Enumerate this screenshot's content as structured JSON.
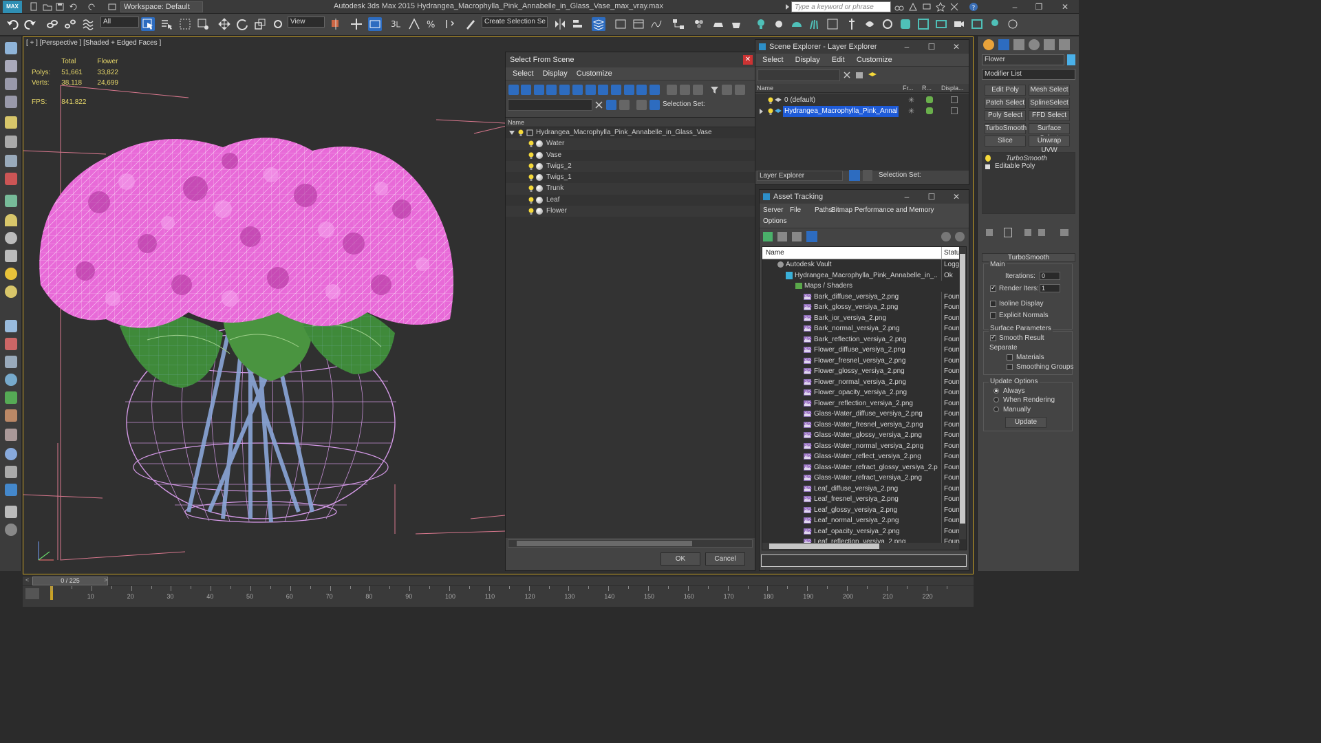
{
  "title_bar": {
    "logo": "MAX",
    "workspace": "Workspace: Default",
    "app_title": "Autodesk 3ds Max  2015     Hydrangea_Macrophylla_Pink_Annabelle_in_Glass_Vase_max_vray.max",
    "search_placeholder": "Type a keyword or phrase",
    "window_buttons": [
      "–",
      "❐",
      "✕"
    ]
  },
  "toolbar": {
    "filter_value": "All",
    "coord_system": "View",
    "selection_set": "Create Selection Se"
  },
  "viewport": {
    "label": "[ + ] [Perspective ] [Shaded + Edged Faces ]",
    "stats": {
      "col_total": "Total",
      "col_flower": "Flower",
      "polys_label": "Polys:",
      "polys_total": "51,661",
      "polys_flower": "33,822",
      "verts_label": "Verts:",
      "verts_total": "38,118",
      "verts_flower": "24,699",
      "fps_label": "FPS:",
      "fps_value": "841.822"
    }
  },
  "select_from_scene": {
    "title": "Select From Scene",
    "menu": [
      "Select",
      "Display",
      "Customize"
    ],
    "selection_set_label": "Selection Set:",
    "column_name": "Name",
    "root": "Hydrangea_Macrophylla_Pink_Annabelle_in_Glass_Vase",
    "children": [
      "Water",
      "Vase",
      "Twigs_2",
      "Twigs_1",
      "Trunk",
      "Leaf",
      "Flower"
    ],
    "ok": "OK",
    "cancel": "Cancel"
  },
  "scene_explorer": {
    "title": "Scene Explorer - Layer Explorer",
    "menu": [
      "Select",
      "Display",
      "Edit",
      "Customize"
    ],
    "columns": [
      "Name",
      "Fr...",
      "R...",
      "Displa..."
    ],
    "rows": [
      "0 (default)",
      "Hydrangea_Macrophylla_Pink_Annabell..."
    ],
    "mode": "Layer Explorer",
    "selection_set_label": "Selection Set:"
  },
  "asset_tracking": {
    "title": "Asset Tracking",
    "menu": [
      "Server",
      "File",
      "Paths",
      "Bitmap Performance and Memory",
      "Options"
    ],
    "col_name": "Name",
    "col_status": "Statu",
    "vault": {
      "name": "Autodesk Vault",
      "status": "Logg"
    },
    "file": {
      "name": "Hydrangea_Macrophylla_Pink_Annabelle_in_...",
      "status": "Ok"
    },
    "folder": "Maps / Shaders",
    "maps": [
      {
        "name": "Bark_diffuse_versiya_2.png",
        "status": "Foun"
      },
      {
        "name": "Bark_glossy_versiya_2.png",
        "status": "Foun"
      },
      {
        "name": "Bark_ior_versiya_2.png",
        "status": "Foun"
      },
      {
        "name": "Bark_normal_versiya_2.png",
        "status": "Foun"
      },
      {
        "name": "Bark_reflection_versiya_2.png",
        "status": "Foun"
      },
      {
        "name": "Flower_diffuse_versiya_2.png",
        "status": "Foun"
      },
      {
        "name": "Flower_fresnel_versiya_2.png",
        "status": "Foun"
      },
      {
        "name": "Flower_glossy_versiya_2.png",
        "status": "Foun"
      },
      {
        "name": "Flower_normal_versiya_2.png",
        "status": "Foun"
      },
      {
        "name": "Flower_opacity_versiya_2.png",
        "status": "Foun"
      },
      {
        "name": "Flower_reflection_versiya_2.png",
        "status": "Foun"
      },
      {
        "name": "Glass-Water_diffuse_versiya_2.png",
        "status": "Foun"
      },
      {
        "name": "Glass-Water_fresnel_versiya_2.png",
        "status": "Foun"
      },
      {
        "name": "Glass-Water_glossy_versiya_2.png",
        "status": "Foun"
      },
      {
        "name": "Glass-Water_normal_versiya_2.png",
        "status": "Foun"
      },
      {
        "name": "Glass-Water_reflect_versiya_2.png",
        "status": "Foun"
      },
      {
        "name": "Glass-Water_refract_glossy_versiya_2.p...",
        "status": "Foun"
      },
      {
        "name": "Glass-Water_refract_versiya_2.png",
        "status": "Foun"
      },
      {
        "name": "Leaf_diffuse_versiya_2.png",
        "status": "Foun"
      },
      {
        "name": "Leaf_fresnel_versiya_2.png",
        "status": "Foun"
      },
      {
        "name": "Leaf_glossy_versiya_2.png",
        "status": "Foun"
      },
      {
        "name": "Leaf_normal_versiya_2.png",
        "status": "Foun"
      },
      {
        "name": "Leaf_opacity_versiya_2.png",
        "status": "Foun"
      },
      {
        "name": "Leaf_reflection_versiya_2.png",
        "status": "Foun"
      }
    ]
  },
  "command_panel": {
    "object_name": "Flower",
    "modifier_list": "Modifier List",
    "buttons": [
      "Edit Poly",
      "Mesh Select",
      "Patch Select",
      "SplineSelect",
      "Poly Select",
      "FFD Select",
      "TurboSmooth",
      "Surface Select",
      "Slice",
      "Unwrap UVW"
    ],
    "stack": [
      "TurboSmooth",
      "Editable Poly"
    ],
    "rollout_title": "TurboSmooth",
    "main_label": "Main",
    "iterations_label": "Iterations:",
    "iterations_value": "0",
    "render_iters_label": "Render Iters:",
    "render_iters_value": "1",
    "isoline_label": "Isoline Display",
    "explicit_label": "Explicit Normals",
    "surface_params_label": "Surface Parameters",
    "smooth_result_label": "Smooth Result",
    "separate_label": "Separate",
    "materials_label": "Materials",
    "smoothing_groups_label": "Smoothing Groups",
    "update_options_label": "Update Options",
    "always_label": "Always",
    "when_rendering_label": "When Rendering",
    "manually_label": "Manually",
    "update_button": "Update"
  },
  "timeline": {
    "frame_counter": "0 / 225",
    "ticks": [
      "10",
      "20",
      "30",
      "40",
      "50",
      "60",
      "70",
      "80",
      "90",
      "100",
      "110",
      "120",
      "130",
      "140",
      "150",
      "160",
      "170",
      "180",
      "190",
      "200",
      "210",
      "220"
    ]
  },
  "colors": {
    "flower": "#e86ad8",
    "leaf": "#3f8a3a",
    "vase_wire": "#d59ae8",
    "stem": "#8aa6d8",
    "selection_highlight": "#1e5bd8",
    "viewport_border": "#c9a227"
  }
}
